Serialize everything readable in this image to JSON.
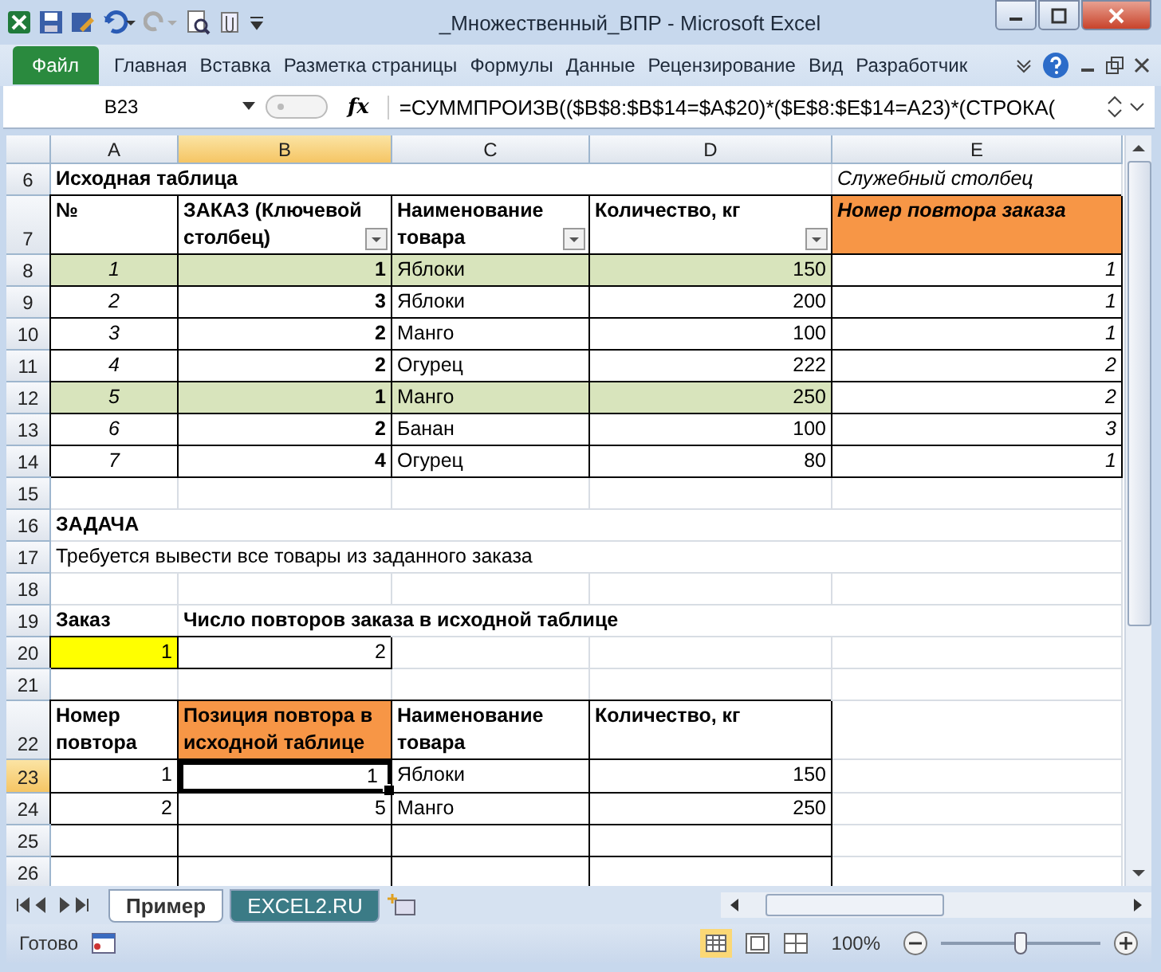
{
  "window": {
    "title": "_Множественный_ВПР  -  Microsoft Excel"
  },
  "ribbon_tabs": [
    {
      "label": "Файл",
      "kind": "file",
      "selected": false
    },
    {
      "label": "Главная",
      "kind": "tab",
      "selected": false
    },
    {
      "label": "Вставка",
      "kind": "tab",
      "selected": false
    },
    {
      "label": "Разметка страницы",
      "kind": "tab",
      "selected": false
    },
    {
      "label": "Формулы",
      "kind": "tab",
      "selected": false
    },
    {
      "label": "Данные",
      "kind": "tab",
      "selected": false
    },
    {
      "label": "Рецензирование",
      "kind": "tab",
      "selected": false
    },
    {
      "label": "Вид",
      "kind": "tab",
      "selected": false
    },
    {
      "label": "Разработчик",
      "kind": "tab",
      "selected": false
    }
  ],
  "formula_bar": {
    "name_box": "B23",
    "fx": "fx",
    "formula": "=СУММПРОИЗВ(($B$8:$B$14=$A$20)*($E$8:$E$14=A23)*(СТРОКА("
  },
  "columns": [
    "A",
    "B",
    "C",
    "D",
    "E"
  ],
  "rows": [
    {
      "num": "6",
      "kind": "caption",
      "cells": [
        {
          "text": "Исходная таблица"
        },
        {},
        {},
        {},
        {
          "text": "Служебный столбец"
        }
      ]
    },
    {
      "num": "7",
      "kind": "header",
      "cells": [
        {
          "text": "№",
          "highlighted": false
        },
        {
          "text": "ЗАКАЗ (Ключевой столбец)",
          "filter": true,
          "highlighted": false
        },
        {
          "text": "Наименование товара",
          "filter": true,
          "highlighted": false
        },
        {
          "text": "Количество, кг",
          "filter": true,
          "highlighted": false
        },
        {
          "text": "Номер повтора заказа",
          "highlighted": true
        }
      ]
    },
    {
      "num": "8",
      "kind": "data",
      "highlighted": true,
      "cells": [
        {
          "text": "1"
        },
        {
          "text": "1"
        },
        {
          "text": "Яблоки"
        },
        {
          "text": "150"
        },
        {
          "text": "1"
        }
      ]
    },
    {
      "num": "9",
      "kind": "data",
      "highlighted": false,
      "cells": [
        {
          "text": "2"
        },
        {
          "text": "3"
        },
        {
          "text": "Яблоки"
        },
        {
          "text": "200"
        },
        {
          "text": "1"
        }
      ]
    },
    {
      "num": "10",
      "kind": "data",
      "highlighted": false,
      "cells": [
        {
          "text": "3"
        },
        {
          "text": "2"
        },
        {
          "text": "Манго"
        },
        {
          "text": "100"
        },
        {
          "text": "1"
        }
      ]
    },
    {
      "num": "11",
      "kind": "data",
      "highlighted": false,
      "cells": [
        {
          "text": "4"
        },
        {
          "text": "2"
        },
        {
          "text": "Огурец"
        },
        {
          "text": "222"
        },
        {
          "text": "2"
        }
      ]
    },
    {
      "num": "12",
      "kind": "data",
      "highlighted": true,
      "cells": [
        {
          "text": "5"
        },
        {
          "text": "1"
        },
        {
          "text": "Манго"
        },
        {
          "text": "250"
        },
        {
          "text": "2"
        }
      ]
    },
    {
      "num": "13",
      "kind": "data",
      "highlighted": false,
      "cells": [
        {
          "text": "6"
        },
        {
          "text": "2"
        },
        {
          "text": "Банан"
        },
        {
          "text": "100"
        },
        {
          "text": "3"
        }
      ]
    },
    {
      "num": "14",
      "kind": "data",
      "highlighted": false,
      "cells": [
        {
          "text": "7"
        },
        {
          "text": "4"
        },
        {
          "text": "Огурец"
        },
        {
          "text": "80"
        },
        {
          "text": "1"
        }
      ]
    },
    {
      "num": "15",
      "kind": "text",
      "cells": []
    },
    {
      "num": "16",
      "kind": "heading",
      "cells": [
        {
          "text": "ЗАДАЧА"
        }
      ]
    },
    {
      "num": "17",
      "kind": "text",
      "cells": [
        {
          "text": "Требуется вывести все товары из заданного заказа"
        }
      ]
    },
    {
      "num": "18",
      "kind": "text",
      "cells": []
    },
    {
      "num": "19",
      "kind": "heading",
      "cells": [
        {
          "text": "Заказ"
        },
        {
          "text": "Число повторов заказа в исходной таблице"
        }
      ]
    },
    {
      "num": "20",
      "kind": "input",
      "cells": [
        {
          "text": "1",
          "highlighted": true
        },
        {
          "text": "2",
          "highlighted": false
        }
      ]
    },
    {
      "num": "21",
      "kind": "text",
      "cells": []
    },
    {
      "num": "22",
      "kind": "header",
      "cells": [
        {
          "text": "Номер повтора",
          "highlighted": false
        },
        {
          "text": "Позиция повтора в исходной таблице",
          "highlighted": true
        },
        {
          "text": "Наименование товара",
          "highlighted": false
        },
        {
          "text": "Количество, кг",
          "highlighted": false
        }
      ]
    },
    {
      "num": "23",
      "kind": "result",
      "cells": [
        {
          "text": "1",
          "selected": false
        },
        {
          "text": "1",
          "selected": true
        },
        {
          "text": "Яблоки",
          "selected": false
        },
        {
          "text": "150",
          "selected": false
        }
      ]
    },
    {
      "num": "24",
      "kind": "result",
      "cells": [
        {
          "text": "2",
          "selected": false
        },
        {
          "text": "5",
          "selected": false
        },
        {
          "text": "Манго",
          "selected": false
        },
        {
          "text": "250",
          "selected": false
        }
      ]
    },
    {
      "num": "25",
      "kind": "result",
      "cells": [
        {},
        {},
        {},
        {}
      ]
    },
    {
      "num": "26",
      "kind": "result",
      "cells": [
        {},
        {},
        {},
        {}
      ]
    }
  ],
  "sheet_tabs": [
    {
      "label": "Пример",
      "selected": true
    },
    {
      "label": "EXCEL2.RU",
      "selected": false
    }
  ],
  "status_bar": {
    "status": "Готово",
    "zoom": "100%",
    "zoom_slider": {
      "level": 0.5
    }
  }
}
